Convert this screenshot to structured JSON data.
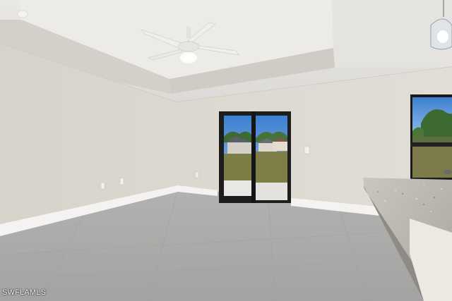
{
  "watermark": {
    "text": "SWFLAMLS"
  }
}
